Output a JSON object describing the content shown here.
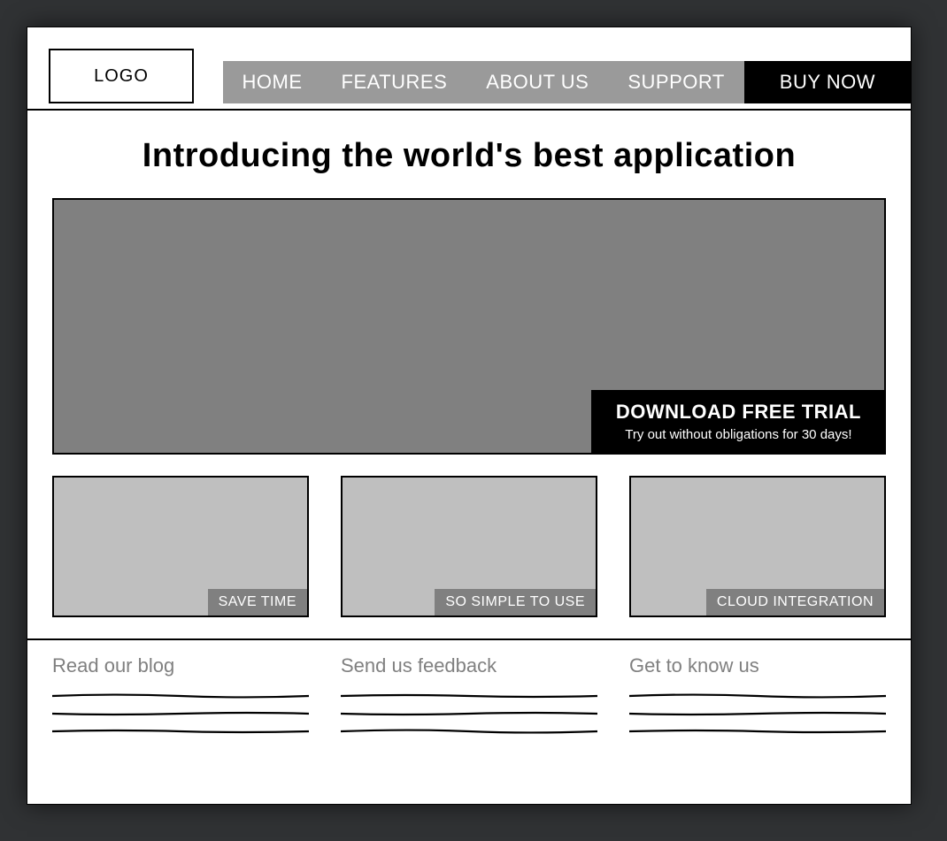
{
  "logo": "LOGO",
  "nav": {
    "items": [
      "HOME",
      "FEATURES",
      "ABOUT US",
      "SUPPORT"
    ],
    "cta": "BUY NOW"
  },
  "hero": {
    "headline": "Introducing the world's best application",
    "cta_title": "DOWNLOAD FREE TRIAL",
    "cta_sub": "Try out without obligations for 30 days!"
  },
  "features": [
    {
      "caption": "SAVE TIME"
    },
    {
      "caption": "SO SIMPLE TO USE"
    },
    {
      "caption": "CLOUD INTEGRATION"
    }
  ],
  "footer": [
    {
      "title": "Read our blog"
    },
    {
      "title": "Send us feedback"
    },
    {
      "title": "Get to know us"
    }
  ]
}
